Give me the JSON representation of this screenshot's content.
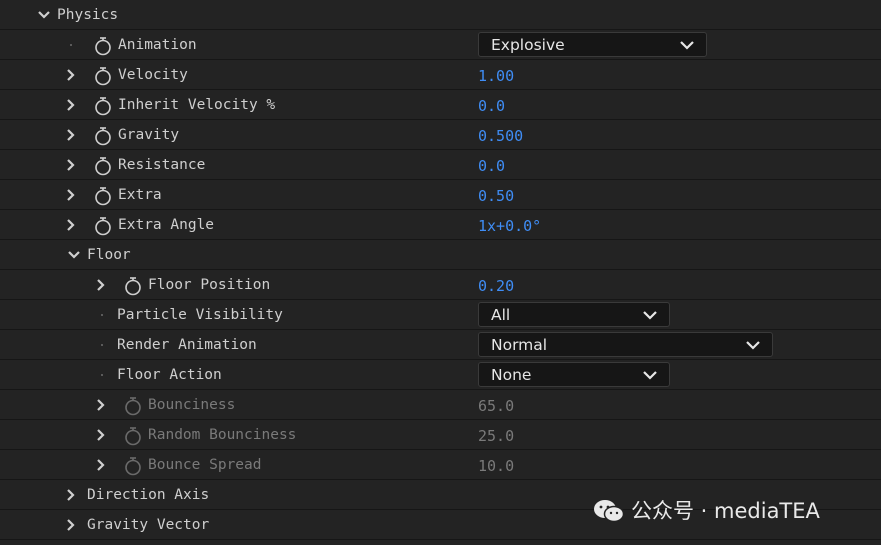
{
  "section": {
    "title": "Physics"
  },
  "rows": {
    "animation": {
      "label": "Animation",
      "value": "Explosive"
    },
    "velocity": {
      "label": "Velocity",
      "value": "1.00"
    },
    "inherit_velocity": {
      "label": "Inherit Velocity %",
      "value": "0.0"
    },
    "gravity": {
      "label": "Gravity",
      "value": "0.500"
    },
    "resistance": {
      "label": "Resistance",
      "value": "0.0"
    },
    "extra": {
      "label": "Extra",
      "value": "0.50"
    },
    "extra_angle": {
      "label": "Extra Angle",
      "value": "1x+0.0°"
    },
    "floor": {
      "label": "Floor"
    },
    "floor_position": {
      "label": "Floor Position",
      "value": "0.20"
    },
    "particle_visibility": {
      "label": "Particle Visibility",
      "value": "All"
    },
    "render_animation": {
      "label": "Render Animation",
      "value": "Normal"
    },
    "floor_action": {
      "label": "Floor Action",
      "value": "None"
    },
    "bounciness": {
      "label": "Bounciness",
      "value": "65.0"
    },
    "random_bounciness": {
      "label": "Random Bounciness",
      "value": "25.0"
    },
    "bounce_spread": {
      "label": "Bounce Spread",
      "value": "10.0"
    },
    "direction_axis": {
      "label": "Direction Axis"
    },
    "gravity_vector": {
      "label": "Gravity Vector"
    }
  },
  "watermark": {
    "text": "公众号 · mediaTEA"
  },
  "colors": {
    "value": "#3f8df5",
    "background": "#232323",
    "text": "#cfcfcf",
    "disabled": "#7a7a7a"
  }
}
